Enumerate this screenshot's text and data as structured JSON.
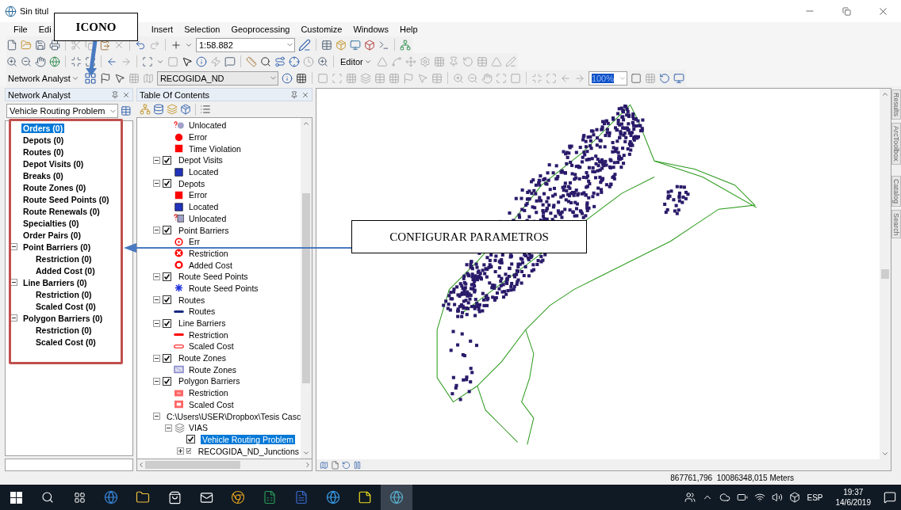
{
  "window": {
    "title": "Sin titul"
  },
  "menu": [
    "File",
    "Edi",
    "Insert",
    "Selection",
    "Geoprocessing",
    "Customize",
    "Windows",
    "Help"
  ],
  "toolbars": {
    "scale": "1:58.882",
    "editor": "Editor",
    "network_analyst": "Network Analyst",
    "network_dataset": "RECOGIDA_ND",
    "zoom": "100%"
  },
  "network_analyst": {
    "title": "Network Analyst",
    "analysis": "Vehicle Routing Problem",
    "items": [
      {
        "label": "Orders (0)",
        "selected": true
      },
      {
        "label": "Depots (0)",
        "selected": false
      },
      {
        "label": "Routes (0)",
        "selected": false
      },
      {
        "label": "Depot Visits (0)",
        "selected": false
      },
      {
        "label": "Breaks (0)",
        "selected": false
      },
      {
        "label": "Route Zones (0)",
        "selected": false
      },
      {
        "label": "Route Seed Points (0)",
        "selected": false
      },
      {
        "label": "Route Renewals (0)",
        "selected": false
      },
      {
        "label": "Specialties (0)",
        "selected": false
      },
      {
        "label": "Order Pairs (0)",
        "selected": false
      },
      {
        "label": "Point Barriers (0)",
        "selected": false,
        "expanded": true,
        "children": [
          {
            "label": "Restriction (0)",
            "selected": false
          },
          {
            "label": "Added Cost (0)",
            "selected": false
          }
        ]
      },
      {
        "label": "Line Barriers (0)",
        "selected": false,
        "expanded": true,
        "children": [
          {
            "label": "Restriction (0)",
            "selected": false
          },
          {
            "label": "Scaled Cost (0)",
            "selected": false
          }
        ]
      },
      {
        "label": "Polygon Barriers (0)",
        "selected": false,
        "expanded": true,
        "children": [
          {
            "label": "Restriction (0)",
            "selected": false
          },
          {
            "label": "Scaled Cost (0)",
            "selected": false
          }
        ]
      }
    ]
  },
  "toc": {
    "title": "Table Of Contents",
    "items": [
      {
        "kind": "unlocated-circle",
        "label": "Unlocated"
      },
      {
        "kind": "red-circle",
        "label": "Error"
      },
      {
        "kind": "red-square",
        "label": "Time Violation"
      },
      {
        "kind": "layer",
        "label": "Depot Visits",
        "checked": true,
        "expanded": true,
        "selected": false,
        "children": [
          {
            "kind": "blue-square",
            "label": "Located"
          }
        ]
      },
      {
        "kind": "layer",
        "label": "Depots",
        "checked": true,
        "expanded": true,
        "selected": false,
        "children": [
          {
            "kind": "red-square",
            "label": "Error"
          },
          {
            "kind": "blue-square",
            "label": "Located"
          },
          {
            "kind": "unlocated-square",
            "label": "Unlocated"
          }
        ]
      },
      {
        "kind": "layer",
        "label": "Point Barriers",
        "checked": true,
        "expanded": true,
        "selected": false,
        "children": [
          {
            "kind": "error-circle",
            "label": "Err"
          },
          {
            "kind": "cross-circle",
            "label": "Restriction"
          },
          {
            "kind": "ring",
            "label": "Added Cost"
          }
        ]
      },
      {
        "kind": "layer",
        "label": "Route Seed Points",
        "checked": true,
        "expanded": true,
        "selected": false,
        "children": [
          {
            "kind": "asterisk",
            "label": "Route Seed Points"
          }
        ]
      },
      {
        "kind": "layer",
        "label": "Routes",
        "checked": true,
        "expanded": true,
        "selected": false,
        "children": [
          {
            "kind": "blue-line",
            "label": "Routes"
          }
        ]
      },
      {
        "kind": "layer",
        "label": "Line Barriers",
        "checked": true,
        "expanded": true,
        "selected": false,
        "children": [
          {
            "kind": "red-line",
            "label": "Restriction"
          },
          {
            "kind": "hollow-line",
            "label": "Scaled Cost"
          }
        ]
      },
      {
        "kind": "layer",
        "label": "Route Zones",
        "checked": true,
        "expanded": true,
        "selected": false,
        "children": [
          {
            "kind": "zone",
            "label": "Route Zones"
          }
        ]
      },
      {
        "kind": "layer",
        "label": "Polygon Barriers",
        "checked": true,
        "expanded": true,
        "selected": false,
        "children": [
          {
            "kind": "red-polygon",
            "label": "Restriction"
          },
          {
            "kind": "hollow-polygon",
            "label": "Scaled Cost"
          }
        ]
      },
      {
        "kind": "workspace",
        "label": "C:\\Users\\USER\\Dropbox\\Tesis Casc",
        "expanded": true,
        "selected": false,
        "children": [
          {
            "kind": "dataset",
            "label": "VIAS",
            "expanded": true,
            "selected": false,
            "children": [
              {
                "kind": "layer",
                "label": "Vehicle Routing Problem",
                "checked": true,
                "selected": true
              },
              {
                "kind": "layer",
                "label": "RECOGIDA_ND_Junctions",
                "checked": true,
                "expanded": false,
                "selected": false
              }
            ]
          }
        ]
      }
    ]
  },
  "side_tabs": [
    "Results",
    "ArcToolbox",
    "Catalog",
    "Search"
  ],
  "status_bar": {
    "coordinates": "867761,796  10086348,015 Meters"
  },
  "taskbar": {
    "language": "ESP",
    "time": "19:37",
    "date": "14/6/2019"
  },
  "annotations": {
    "icon_label": "ICONO",
    "config_label": "CONFIGURAR PARAMETROS"
  }
}
